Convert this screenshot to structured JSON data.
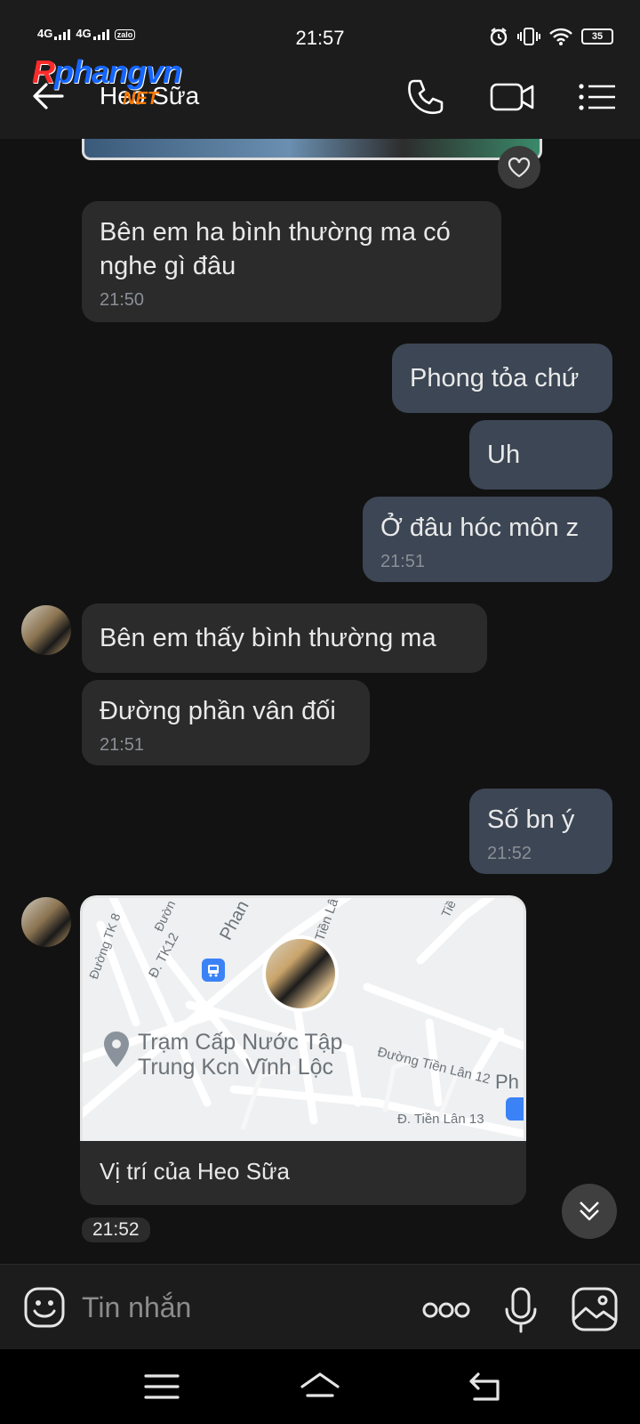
{
  "status_bar": {
    "sim1": "4G",
    "sim2": "4G",
    "app_icon": "zalo",
    "time": "21:57",
    "battery": "35",
    "icons": [
      "alarm-icon",
      "vibrate-icon",
      "wifi-icon",
      "battery-icon"
    ]
  },
  "watermark": {
    "r": "R",
    "main": "phangvn",
    "net": "NET"
  },
  "header": {
    "contact_name": "Heo Sữa",
    "icons": [
      "back-arrow-icon",
      "phone-icon",
      "video-call-icon",
      "menu-list-icon"
    ]
  },
  "messages": [
    {
      "side": "in",
      "text": "Bên em ha bình thường ma có nghe gì đâu",
      "time": "21:50"
    },
    {
      "side": "out",
      "text": "Phong tỏa chứ",
      "time": ""
    },
    {
      "side": "out",
      "text": "Uh",
      "time": ""
    },
    {
      "side": "out",
      "text": "Ở đâu hóc môn z",
      "time": "21:51"
    },
    {
      "side": "in",
      "text": "Bên em thấy bình thường ma",
      "time": ""
    },
    {
      "side": "in",
      "text": "Đường phần vân đối",
      "time": "21:51"
    },
    {
      "side": "out",
      "text": "Số bn ý",
      "time": "21:52"
    }
  ],
  "location": {
    "map_labels": {
      "poi_line1": "Trạm Cấp Nước Tập",
      "poi_line2": "Trung Kcn Vĩnh Lộc",
      "road1": "Đường Tiền Lân 12",
      "road2": "Đ. Tiền Lân 13",
      "road3": "Phan",
      "road4": "Đ. TK12",
      "road5": "Đường TK 8",
      "road6": "Tiền Lâ",
      "road7": "Đườn",
      "road8": "Tiề",
      "road9": "Ph"
    },
    "label": "Vị trí của Heo Sữa",
    "time": "21:52"
  },
  "input": {
    "placeholder": "Tin nhắn"
  },
  "nav": {
    "icons": [
      "recent-apps-icon",
      "home-icon",
      "back-icon"
    ]
  }
}
